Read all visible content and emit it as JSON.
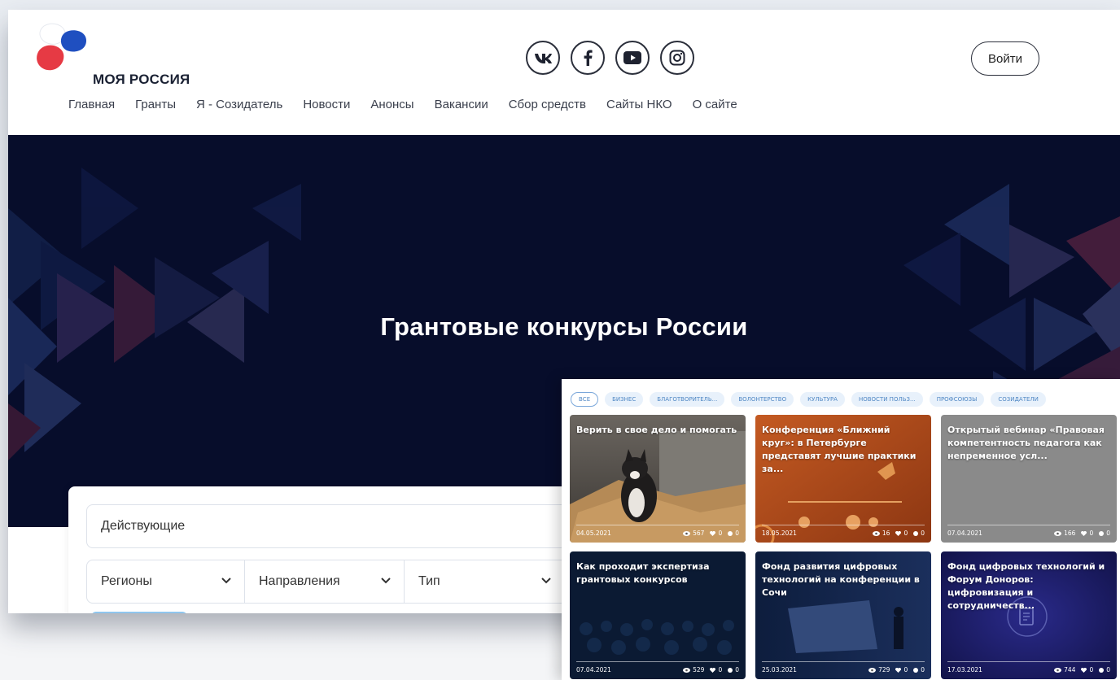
{
  "header": {
    "logo_text": "МОЯ РОССИЯ",
    "socials": [
      "vk-icon",
      "facebook-icon",
      "youtube-icon",
      "instagram-icon"
    ],
    "login_label": "Войти"
  },
  "nav": {
    "items": [
      "Главная",
      "Гранты",
      "Я - Созидатель",
      "Новости",
      "Анонсы",
      "Вакансии",
      "Сбор средств",
      "Сайты НКО",
      "О сайте"
    ]
  },
  "hero": {
    "title": "Грантовые конкурсы России"
  },
  "filters": {
    "status": "Действующие",
    "regions": "Регионы",
    "directions": "Направления",
    "type": "Тип"
  },
  "news_panel": {
    "chips": [
      "ВСЕ",
      "БИЗНЕС",
      "БЛАГОТВОРИТЕЛЬ...",
      "ВОЛОНТЕРСТВО",
      "КУЛЬТУРА",
      "НОВОСТИ ПОЛЬЗ...",
      "ПРОФСОЮЗЫ",
      "СОЗИДАТЕЛИ"
    ],
    "cards": [
      {
        "title": "Верить в свое дело и помогать",
        "date": "04.05.2021",
        "views": "567",
        "likes": "0",
        "comments": "0"
      },
      {
        "title": "Конференция «Ближний круг»: в Петербурге представят лучшие практики за...",
        "date": "18.05.2021",
        "views": "16",
        "likes": "0",
        "comments": "0"
      },
      {
        "title": "Открытый вебинар «Правовая компетентность педагога как непременное усл...",
        "date": "07.04.2021",
        "views": "166",
        "likes": "0",
        "comments": "0"
      },
      {
        "title": "Как проходит экспертиза грантовых конкурсов",
        "date": "07.04.2021",
        "views": "529",
        "likes": "0",
        "comments": "0"
      },
      {
        "title": "Фонд развития цифровых технологий на конференции в Сочи",
        "date": "25.03.2021",
        "views": "729",
        "likes": "0",
        "comments": "0"
      },
      {
        "title": "Фонд цифровых технологий и Форум Доноров: цифровизация и сотрудничеств...",
        "date": "17.03.2021",
        "views": "744",
        "likes": "0",
        "comments": "0"
      }
    ]
  },
  "colors": {
    "hero_bg": "#070d2b",
    "chip_bg": "#e8f1fb",
    "chip_text": "#4f87c4",
    "accent_button": "#8ec6ee"
  }
}
